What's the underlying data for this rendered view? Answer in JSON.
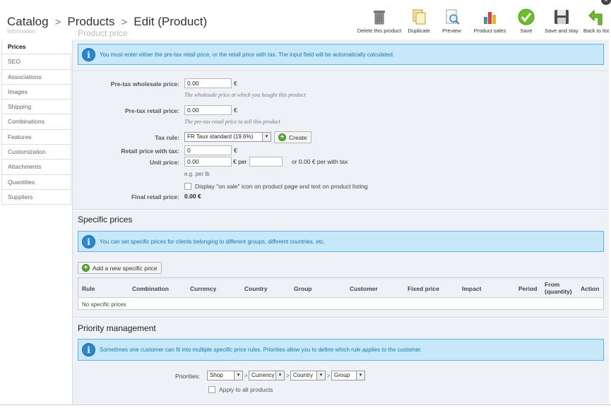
{
  "breadcrumb": [
    "Catalog",
    "Products",
    "Edit (Product)"
  ],
  "ghost_title": "Product price",
  "ghost_tab": "Information",
  "toolbar": [
    {
      "label": "Delete this product",
      "icon": "trash-icon"
    },
    {
      "label": "Duplicate",
      "icon": "duplicate-icon"
    },
    {
      "label": "Preview",
      "icon": "preview-icon"
    },
    {
      "label": "Product sales",
      "icon": "chart-icon"
    },
    {
      "label": "Save",
      "icon": "checkmark-icon"
    },
    {
      "label": "Save and stay",
      "icon": "floppy-icon"
    },
    {
      "label": "Back to list",
      "icon": "back-arrow-icon"
    }
  ],
  "tabs": [
    "Prices",
    "SEO",
    "Associations",
    "Images",
    "Shipping",
    "Combinations",
    "Features",
    "Customization",
    "Attachments",
    "Quantities",
    "Suppliers"
  ],
  "active_tab": "Prices",
  "price_info": "You must enter either the pre-tax retail price, or the retail price with tax. The input field will be automatically calculated.",
  "fields": {
    "wholesale_label": "Pre-tax wholesale price:",
    "wholesale_value": "0.00",
    "wholesale_hint": "The wholesale price at which you bought this product",
    "retail_label": "Pre-tax retail price:",
    "retail_value": "0.00",
    "retail_hint": "The pre-tax retail price to sell this product",
    "tax_label": "Tax rule:",
    "tax_value": "FR Taux standard (19.6%)",
    "create_label": "Create",
    "with_tax_label": "Retail price with tax:",
    "with_tax_value": "0",
    "unit_label": "Unit price:",
    "unit_value": "0.00",
    "unit_per": "€ per",
    "unit_with_tax": "or 0.00 € per with tax",
    "unit_example": "e.g. per lb",
    "on_sale_label": "Display \"on sale\" icon on product page and text on product listing",
    "final_label": "Final retail price:",
    "final_value": "0.00 €",
    "currency": "€"
  },
  "specific": {
    "title": "Specific prices",
    "info": "You can set specific prices for clients belonging to different groups, different countries, etc.",
    "add_label": "Add a new specific price",
    "columns": [
      "Rule",
      "Combination",
      "Currency",
      "Country",
      "Group",
      "Customer",
      "Fixed price",
      "Impact",
      "Period",
      "From (quantity)",
      "Action"
    ],
    "col_from_line1": "From",
    "col_from_line2": "(quantity)",
    "empty": "No specific prices"
  },
  "priority": {
    "title": "Priority management",
    "info": "Sometimes one customer can fit into multiple specific price rules. Priorities allow you to define which rule applies to the customer.",
    "label": "Priorities:",
    "selects": [
      "Shop",
      "Currency",
      "Country",
      "Group"
    ],
    "apply_all": "Apply to all products"
  },
  "colors": {
    "info_bg": "#c6e8f8",
    "info_border": "#5db5e2",
    "info_text": "#1a75bb",
    "panel_bg": "#eef1f6"
  }
}
